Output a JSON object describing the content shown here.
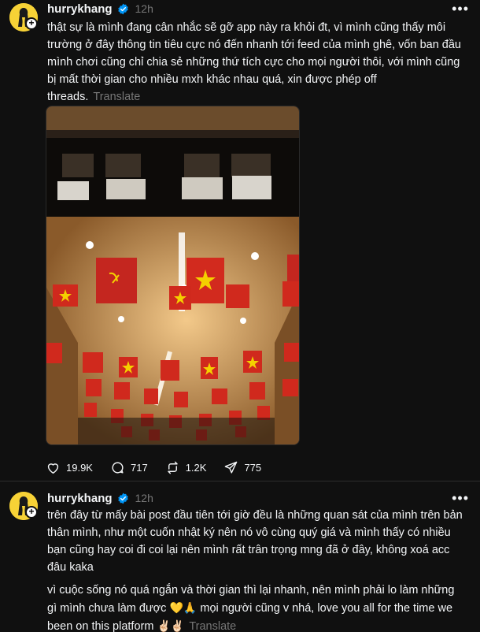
{
  "colors": {
    "background": "#101010",
    "text": "#f3f5f7",
    "muted": "#777777",
    "verified": "#0095f6",
    "avatar_bg": "#f7d236"
  },
  "posts": [
    {
      "username": "hurrykhang",
      "time": "12h",
      "more_icon": "ellipsis-icon",
      "text": "thật sự là mình đang cân nhắc sẽ gỡ app này ra khỏi đt, vì mình cũng thấy môi trường ở đây thông tin tiêu cực nó đến nhanh tới feed của mình ghê, vốn ban đầu mình chơi cũng chỉ chia sẻ những thứ tích cực cho mọi người thôi, với mình cũng bị mất thời gian cho nhiều mxh khác nhau quá, xin được phép off threads.",
      "translate": "Translate",
      "actions": {
        "likes": "19.9K",
        "comments": "717",
        "reposts": "1.2K",
        "shares": "775"
      }
    },
    {
      "username": "hurrykhang",
      "time": "12h",
      "more_icon": "ellipsis-icon",
      "paragraph1": "trên đây từ mấy bài post đầu tiên tới giờ đều là những quan sát của mình trên bản thân mình, như một cuốn nhật ký nên nó vô cùng quý giá và mình thấy có nhiều bạn cũng hay coi đi coi lại nên mình rất trân trọng mng đã ở đây, không xoá acc đâu kaka",
      "paragraph2_a": "vì cuộc sống nó quá ngắn và thời gian thì lại nhanh, nên mình phải lo làm những gì mình chưa làm được",
      "paragraph2_emoji1": "💛🙏",
      "paragraph2_b": "mọi người cũng v nhá, love you all for the time we been on this platform",
      "paragraph2_emoji2": "✌🏻✌🏻",
      "translate": "Translate"
    }
  ]
}
